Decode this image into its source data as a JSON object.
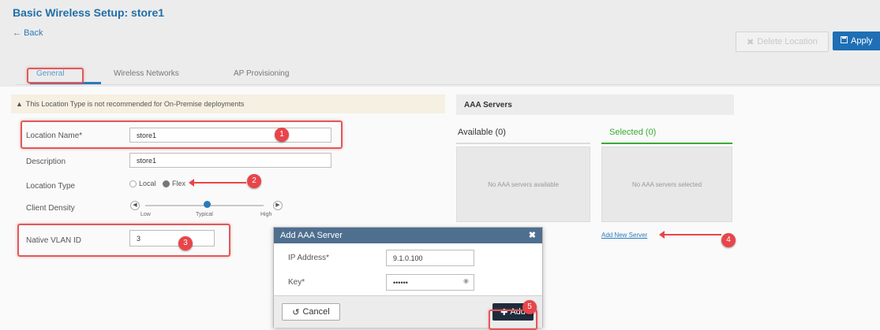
{
  "header": {
    "title": "Basic Wireless Setup: store1",
    "back_label": "Back",
    "delete_label": "Delete Location",
    "apply_label": "Apply"
  },
  "tabs": [
    {
      "label": "General"
    },
    {
      "label": "Wireless Networks"
    },
    {
      "label": "AP Provisioning"
    }
  ],
  "warning": "This Location Type is not recommended for On-Premise deployments",
  "form": {
    "location_name_label": "Location Name*",
    "location_name_value": "store1",
    "description_label": "Description",
    "description_value": "store1",
    "location_type_label": "Location Type",
    "type_local": "Local",
    "type_flex": "Flex",
    "client_density_label": "Client Density",
    "density_low": "Low",
    "density_typical": "Typical",
    "density_high": "High",
    "native_vlan_label": "Native VLAN ID",
    "native_vlan_value": "3"
  },
  "aaa": {
    "title": "AAA Servers",
    "available_label": "Available (0)",
    "selected_label": "Selected (0)",
    "available_empty": "No AAA servers available",
    "selected_empty": "No AAA servers selected",
    "add_link": "Add New Server"
  },
  "modal": {
    "title": "Add AAA Server",
    "ip_label": "IP Address*",
    "ip_value": "9.1.0.100",
    "key_label": "Key*",
    "key_value": "••••••",
    "cancel_label": "Cancel",
    "add_label": "Add"
  },
  "markers": [
    "1",
    "2",
    "3",
    "4",
    "5"
  ],
  "colors": {
    "accent": "#1e6fb5",
    "annotation": "#e8454a",
    "selected_underline": "#3aaa35"
  }
}
